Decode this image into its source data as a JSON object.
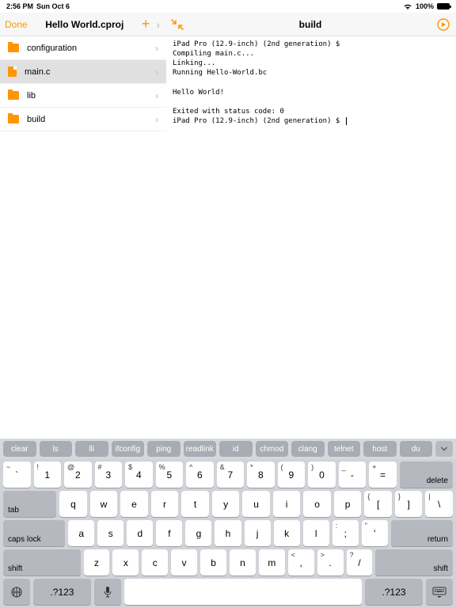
{
  "status": {
    "time": "2:56 PM",
    "date": "Sun Oct 6",
    "wifi": "●",
    "battery_pct": "100%"
  },
  "toolbar": {
    "done": "Done",
    "title": "Hello World.cproj",
    "center_title": "build"
  },
  "sidebar": {
    "items": [
      {
        "label": "configuration",
        "type": "folder"
      },
      {
        "label": "main.c",
        "type": "file",
        "selected": true
      },
      {
        "label": "lib",
        "type": "folder"
      },
      {
        "label": "build",
        "type": "folder"
      }
    ]
  },
  "console": {
    "text": "iPad Pro (12.9-inch) (2nd generation) $\nCompiling main.c...\nLinking...\nRunning Hello-World.bc\n\nHello World!\n\nExited with status code: 0\niPad Pro (12.9-inch) (2nd generation) $ "
  },
  "shortcuts": [
    "clear",
    "ls",
    "lli",
    "ifconfig",
    "ping",
    "readlink",
    "id",
    "chmod",
    "clang",
    "telnet",
    "host",
    "du"
  ],
  "keys": {
    "r1": [
      [
        "~",
        "`"
      ],
      [
        "!",
        "1"
      ],
      [
        "@",
        "2"
      ],
      [
        "#",
        "3"
      ],
      [
        "$",
        "4"
      ],
      [
        "%",
        "5"
      ],
      [
        "^",
        "6"
      ],
      [
        "&",
        "7"
      ],
      [
        "*",
        "8"
      ],
      [
        "(",
        "9"
      ],
      [
        ")",
        "0"
      ],
      [
        "_",
        "-"
      ],
      [
        "+",
        "="
      ]
    ],
    "r1_del": "delete",
    "r2_tab": "tab",
    "r2": [
      "q",
      "w",
      "e",
      "r",
      "t",
      "y",
      "u",
      "i",
      "o",
      "p"
    ],
    "r2b": [
      [
        "{",
        "["
      ],
      [
        "}",
        "]"
      ],
      [
        "|",
        "\\"
      ]
    ],
    "r3_caps": "caps lock",
    "r3": [
      "a",
      "s",
      "d",
      "f",
      "g",
      "h",
      "j",
      "k",
      "l"
    ],
    "r3b": [
      [
        ":",
        ";"
      ],
      [
        "\"",
        "'"
      ]
    ],
    "r3_ret": "return",
    "r4_shift": "shift",
    "r4": [
      "z",
      "x",
      "c",
      "v",
      "b",
      "n",
      "m"
    ],
    "r4b": [
      [
        "<",
        ","
      ],
      [
        ">",
        "."
      ],
      [
        "?",
        "/"
      ]
    ],
    "r5_sym": ".?123"
  }
}
